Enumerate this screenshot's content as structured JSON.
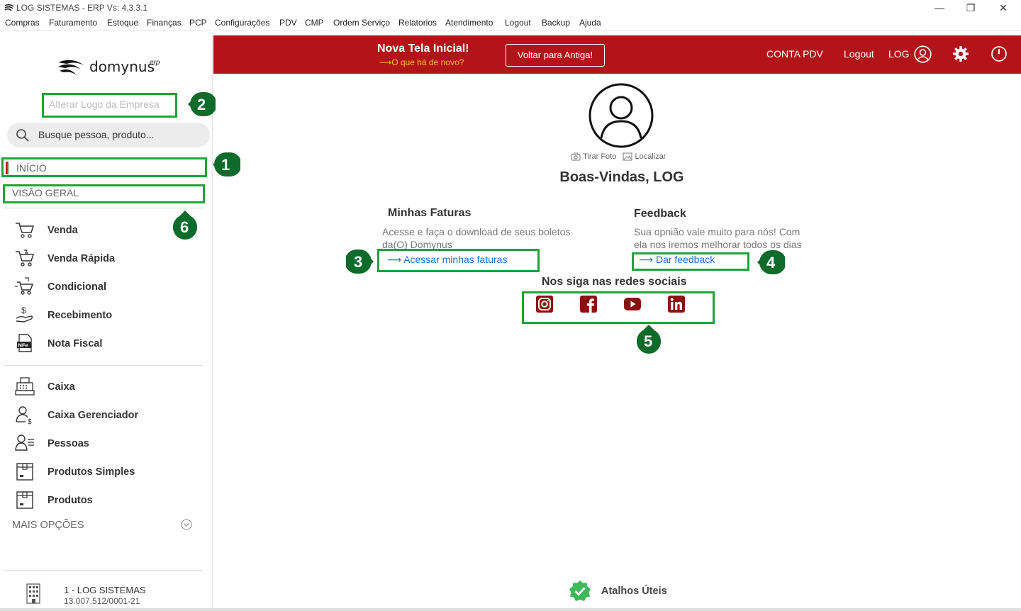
{
  "window": {
    "title": "LOG SISTEMAS - ERP Vs: 4.3.3.1",
    "controls": [
      "—",
      "❐",
      "✕"
    ]
  },
  "menubar": [
    "Compras",
    "Faturamento",
    "Estoque",
    "Finanças",
    "PCP",
    "Configurações",
    "PDV",
    "CMP",
    "Ordem Serviço",
    "Relatorios",
    "Atendimento",
    "Logout",
    "Backup",
    "Ajuda"
  ],
  "sidebar": {
    "logo_text": "domynus",
    "logo_suffix": "erp",
    "alterar_logo": "Alterar Logo da Empresa",
    "search_placeholder": "Busque pessoa, produto...",
    "inicio": "INÍCIO",
    "visao_geral": "VISÃO GERAL",
    "group1": [
      {
        "label": "Venda",
        "icon": "cart-icon"
      },
      {
        "label": "Venda Rápida",
        "icon": "cart-fast-icon"
      },
      {
        "label": "Condicional",
        "icon": "cart-cond-icon"
      },
      {
        "label": "Recebimento",
        "icon": "hand-money-icon"
      },
      {
        "label": "Nota Fiscal",
        "icon": "nfe-icon"
      }
    ],
    "group2": [
      {
        "label": "Caixa",
        "icon": "cash-register-icon"
      },
      {
        "label": "Caixa Gerenciador",
        "icon": "user-money-icon"
      },
      {
        "label": "Pessoas",
        "icon": "people-icon"
      },
      {
        "label": "Produtos Simples",
        "icon": "box-icon"
      },
      {
        "label": "Produtos",
        "icon": "box-icon"
      }
    ],
    "mais_opcoes": "MAIS OPÇÕES",
    "company_name": "1 - LOG SISTEMAS",
    "company_cnpj": "13.007.512/0001-21"
  },
  "topbar": {
    "nova_tela": "Nova Tela Inicial!",
    "o_que_ha": "⟶O que há de novo?",
    "voltar": "Voltar para Antiga!",
    "conta_pdv": "CONTA PDV",
    "logout": "Logout",
    "user": "LOG",
    "colors": {
      "bar": "#b3141a",
      "accent": "#f4c030"
    }
  },
  "main": {
    "tirar_foto": "Tirar Foto",
    "localizar": "Localizar",
    "welcome": "Boas-Vindas, LOG",
    "faturas": {
      "title": "Minhas Faturas",
      "line1": "Acesse e faça o download de seus boletos",
      "line2": "da(O) Domynus",
      "link": "⟶   Acessar minhas faturas"
    },
    "feedback": {
      "title": "Feedback",
      "line1": "Sua opnião vale muito para nós! Com",
      "line2": "ela nos iremos melhorar todos os dias",
      "link": "⟶   Dar feedback"
    },
    "social_title": "Nos siga nas redes sociais",
    "social": [
      "instagram-icon",
      "facebook-icon",
      "youtube-icon",
      "linkedin-icon"
    ],
    "atalhos": "Atalhos Úteis"
  },
  "annotations": {
    "color": "#1fa23a",
    "badges": [
      "1",
      "2",
      "3",
      "4",
      "5",
      "6"
    ]
  }
}
